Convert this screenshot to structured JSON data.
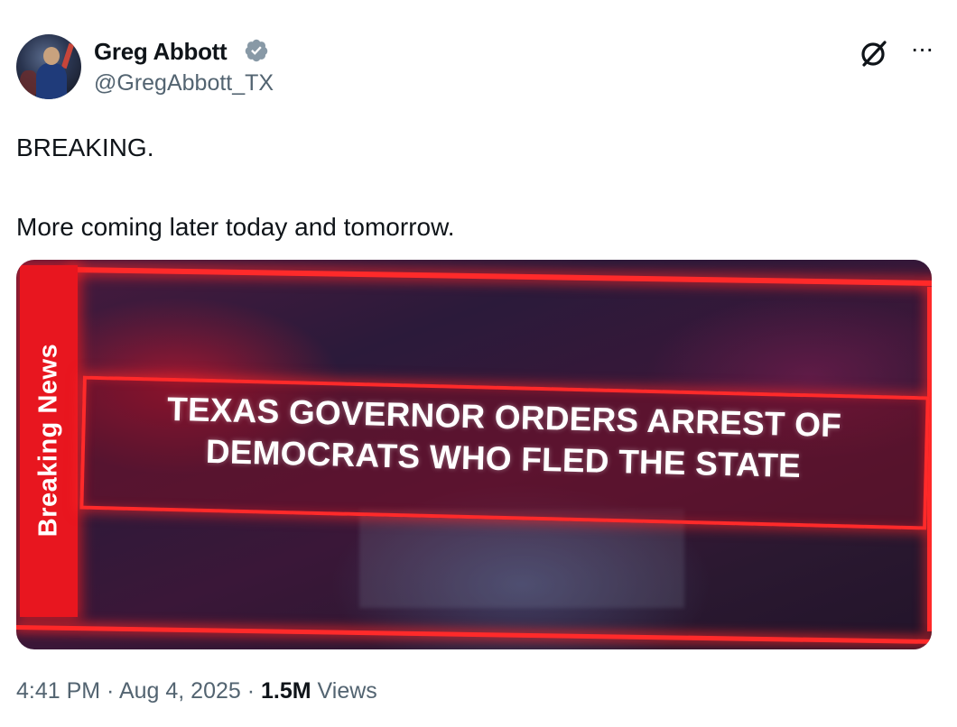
{
  "author": {
    "name": "Greg Abbott",
    "handle": "@GregAbbott_TX",
    "verified": true,
    "avatar_icon": "profile-photo",
    "verified_color": "#1d9bf0"
  },
  "header_actions": {
    "grok_icon": "grok-icon",
    "more_icon": "more-icon",
    "more_glyph": "···"
  },
  "tweet": {
    "lines": [
      "BREAKING.",
      "More coming later today and tomorrow."
    ]
  },
  "media": {
    "side_label": "Breaking News",
    "headline_line1": "TEXAS GOVERNOR ORDERS ARREST OF",
    "headline_line2": "DEMOCRATS WHO FLED THE STATE",
    "accent_color": "#ff2a2a"
  },
  "meta": {
    "time": "4:41 PM",
    "separator": " · ",
    "date": "Aug 4, 2025",
    "views_count": "1.5M",
    "views_label": " Views"
  },
  "colors": {
    "text_primary": "#0f1419",
    "text_secondary": "#536471"
  }
}
